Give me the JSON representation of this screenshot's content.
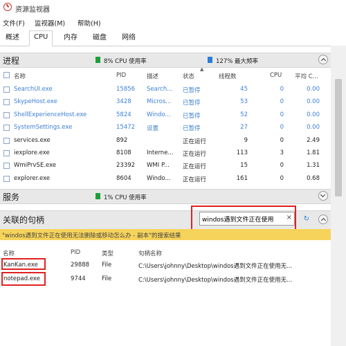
{
  "window": {
    "title": "资源监视器"
  },
  "menu": [
    "文件(F)",
    "监视器(M)",
    "帮助(H)"
  ],
  "tabs": [
    "概述",
    "CPU",
    "内存",
    "磁盘",
    "网络"
  ],
  "active_tab": "CPU",
  "processes": {
    "title": "进程",
    "cpu_stat": "8% CPU 使用率",
    "freq_stat": "127% 最大频率",
    "columns": [
      "名称",
      "PID",
      "描述",
      "状态",
      "线程数",
      "CPU",
      "平均 C..."
    ],
    "rows": [
      {
        "name": "SearchUI.exe",
        "pid": "15856",
        "desc": "Search...",
        "status": "已暂停",
        "threads": "45",
        "cpu": "0",
        "avg": "0.00",
        "suspended": true
      },
      {
        "name": "SkypeHost.exe",
        "pid": "3428",
        "desc": "Micros...",
        "status": "已暂停",
        "threads": "53",
        "cpu": "0",
        "avg": "0.00",
        "suspended": true
      },
      {
        "name": "ShellExperienceHost.exe",
        "pid": "5824",
        "desc": "Windo...",
        "status": "已暂停",
        "threads": "52",
        "cpu": "0",
        "avg": "0.00",
        "suspended": true
      },
      {
        "name": "SystemSettings.exe",
        "pid": "15472",
        "desc": "设置",
        "status": "已暂停",
        "threads": "27",
        "cpu": "0",
        "avg": "0.00",
        "suspended": true
      },
      {
        "name": "services.exe",
        "pid": "892",
        "desc": "",
        "status": "正在运行",
        "threads": "9",
        "cpu": "0",
        "avg": "2.49",
        "suspended": false
      },
      {
        "name": "iexplore.exe",
        "pid": "8108",
        "desc": "Interne...",
        "status": "正在运行",
        "threads": "113",
        "cpu": "3",
        "avg": "1.81",
        "suspended": false
      },
      {
        "name": "WmiPrvSE.exe",
        "pid": "23392",
        "desc": "WMI P...",
        "status": "正在运行",
        "threads": "15",
        "cpu": "0",
        "avg": "1.31",
        "suspended": false
      },
      {
        "name": "explorer.exe",
        "pid": "8604",
        "desc": "Windo...",
        "status": "正在运行",
        "threads": "161",
        "cpu": "0",
        "avg": "0.68",
        "suspended": false
      }
    ]
  },
  "services": {
    "title": "服务",
    "cpu_stat": "1% CPU 使用率"
  },
  "handles": {
    "title": "关联的句柄",
    "search_value": "windos遇到文件正在使用",
    "banner": "\"windos遇到文件正在使用无法删除或移动怎么办 - 副本\"的搜索结果",
    "columns": [
      "名称",
      "PID",
      "类型",
      "句柄名称"
    ],
    "rows": [
      {
        "name": "KanKan.exe",
        "pid": "29888",
        "type": "File",
        "handle": "C:\\Users\\johnny\\Desktop\\windos遇到文件正在使用无..."
      },
      {
        "name": "notepad.exe",
        "pid": "9744",
        "type": "File",
        "handle": "C:\\Users\\johnny\\Desktop\\windos遇到文件正在使用无..."
      }
    ]
  },
  "colors": {
    "accent_red": "#e02020",
    "suspended_blue": "#3b7fd6",
    "cpu_green": "#1e9e3a",
    "freq_blue": "#2a7fd4",
    "banner_yellow": "#f6d35a"
  }
}
